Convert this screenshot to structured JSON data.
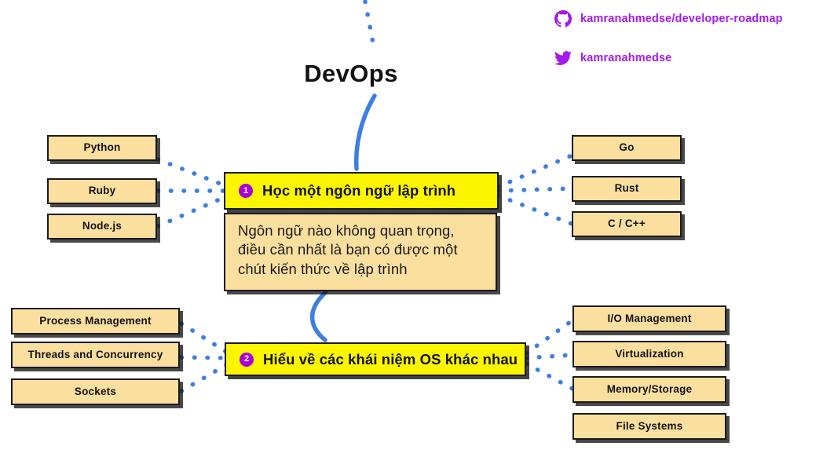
{
  "page": {
    "title": "DevOps",
    "background": "#ffffff",
    "accent_yellow": "#fbf500",
    "accent_beige": "#fbdf9f",
    "accent_purple": "#a21aee",
    "accent_blue": "#3d7fe0"
  },
  "social": {
    "github": {
      "icon": "github-icon",
      "handle": "kamranahmedse/developer-roadmap"
    },
    "twitter": {
      "icon": "twitter-icon",
      "handle": "kamranahmedse"
    }
  },
  "sections": [
    {
      "number": "1",
      "headline": "Học một ngôn ngữ lập trình",
      "description": "Ngôn ngữ nào không quan trọng,\nđiều cần nhất là bạn có được một\nchút kiến thức về lập trình",
      "left_items": [
        {
          "label": "Python"
        },
        {
          "label": "Ruby"
        },
        {
          "label": "Node.js"
        }
      ],
      "right_items": [
        {
          "label": "Go"
        },
        {
          "label": "Rust"
        },
        {
          "label": "C / C++"
        }
      ]
    },
    {
      "number": "2",
      "headline": "Hiểu về các khái niệm OS khác nhau",
      "description": "",
      "left_items": [
        {
          "label": "Process Management"
        },
        {
          "label": "Threads and Concurrency"
        },
        {
          "label": "Sockets"
        }
      ],
      "right_items": [
        {
          "label": "I/O Management"
        },
        {
          "label": "Virtualization"
        },
        {
          "label": "Memory/Storage"
        },
        {
          "label": "File Systems"
        }
      ]
    }
  ]
}
